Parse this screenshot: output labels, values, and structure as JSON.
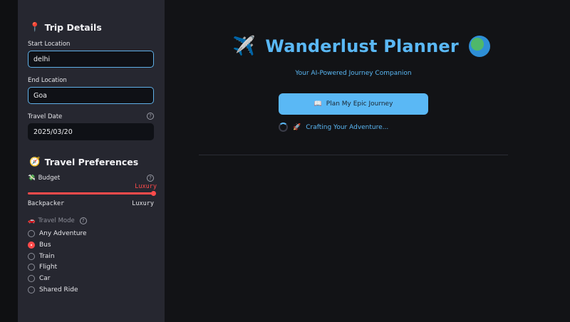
{
  "sidebar": {
    "trip_details": {
      "icon": "📍",
      "title": "Trip Details"
    },
    "start": {
      "label": "Start Location",
      "value": "delhi"
    },
    "end": {
      "label": "End Location",
      "value": "Goa"
    },
    "date": {
      "label": "Travel Date",
      "value": "2025/03/20",
      "help": "?"
    },
    "prefs": {
      "icon": "🧭",
      "title": "Travel Preferences"
    },
    "budget": {
      "icon": "💸",
      "label": "Budget",
      "help": "?",
      "current": "Luxury",
      "min_label": "Backpacker",
      "max_label": "Luxury",
      "level": 1.0
    },
    "mode": {
      "icon": "🚗",
      "label": "Travel Mode",
      "help": "?",
      "options": [
        "Any Adventure",
        "Bus",
        "Train",
        "Flight",
        "Car",
        "Shared Ride"
      ],
      "selected": "Bus"
    }
  },
  "main": {
    "title": "Wanderlust Planner",
    "title_icon_left": "✈️",
    "title_icon_right": "🌍",
    "subtitle": "Your AI-Powered Journey Companion",
    "plan_button": {
      "icon": "📖",
      "label": "Plan My Epic Journey"
    },
    "status": {
      "icon": "🚀",
      "text": "Crafting Your Adventure..."
    }
  },
  "colors": {
    "accent_blue": "#5ab8f5",
    "slider_red": "#ff4b4b",
    "sidebar_bg": "#262730",
    "main_bg": "#121316"
  }
}
